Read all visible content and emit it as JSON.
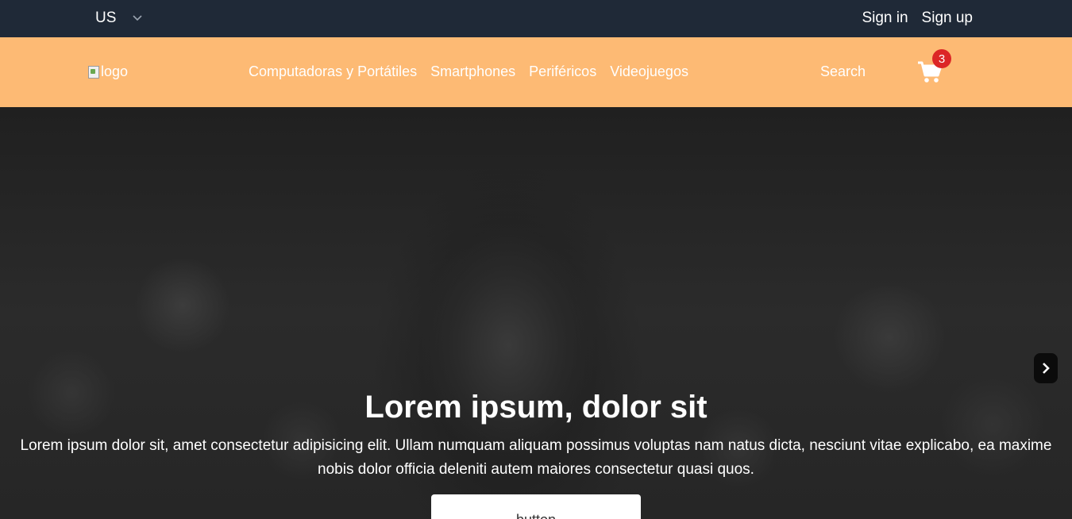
{
  "topbar": {
    "locale": "US",
    "sign_in": "Sign in",
    "sign_up": "Sign up"
  },
  "navbar": {
    "logo_alt": "logo",
    "menu": [
      "Computadoras y Portátiles",
      "Smartphones",
      "Periféricos",
      "Videojuegos"
    ],
    "search": "Search",
    "cart_count": "3"
  },
  "hero": {
    "title": "Lorem ipsum, dolor sit",
    "text_line1": "Lorem ipsum dolor sit, amet consectetur adipisicing elit. Ullam numquam aliquam possimus voluptas nam natus dicta, nesciunt vitae explicabo, ea maxime",
    "text_line2": "nobis dolor officia deleniti autem maiores consectetur quasi quos.",
    "button": "button"
  },
  "colors": {
    "topbar_bg": "#1f2937",
    "navbar_bg": "#fdba74",
    "badge": "#dc2626"
  },
  "icons": {
    "locale_dropdown": "chevron-down-icon",
    "cart": "shopping-cart-icon",
    "carousel_next": "chevron-right-icon"
  }
}
